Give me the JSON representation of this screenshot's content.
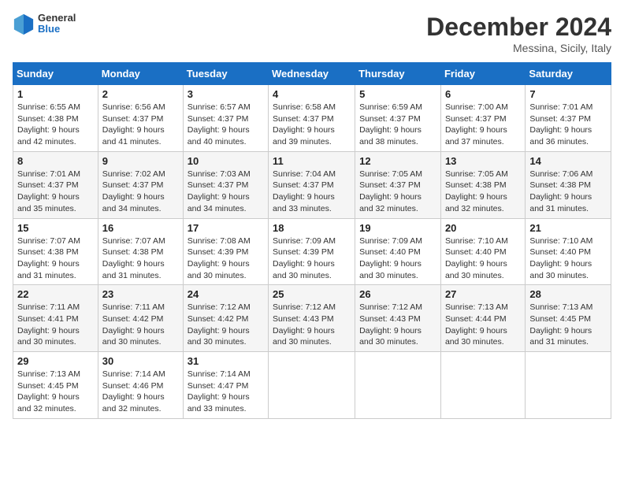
{
  "header": {
    "logo_general": "General",
    "logo_blue": "Blue",
    "title": "December 2024",
    "location": "Messina, Sicily, Italy"
  },
  "weekdays": [
    "Sunday",
    "Monday",
    "Tuesday",
    "Wednesday",
    "Thursday",
    "Friday",
    "Saturday"
  ],
  "weeks": [
    [
      {
        "day": "1",
        "sunrise": "6:55 AM",
        "sunset": "4:38 PM",
        "daylight": "9 hours and 42 minutes."
      },
      {
        "day": "2",
        "sunrise": "6:56 AM",
        "sunset": "4:37 PM",
        "daylight": "9 hours and 41 minutes."
      },
      {
        "day": "3",
        "sunrise": "6:57 AM",
        "sunset": "4:37 PM",
        "daylight": "9 hours and 40 minutes."
      },
      {
        "day": "4",
        "sunrise": "6:58 AM",
        "sunset": "4:37 PM",
        "daylight": "9 hours and 39 minutes."
      },
      {
        "day": "5",
        "sunrise": "6:59 AM",
        "sunset": "4:37 PM",
        "daylight": "9 hours and 38 minutes."
      },
      {
        "day": "6",
        "sunrise": "7:00 AM",
        "sunset": "4:37 PM",
        "daylight": "9 hours and 37 minutes."
      },
      {
        "day": "7",
        "sunrise": "7:01 AM",
        "sunset": "4:37 PM",
        "daylight": "9 hours and 36 minutes."
      }
    ],
    [
      {
        "day": "8",
        "sunrise": "7:01 AM",
        "sunset": "4:37 PM",
        "daylight": "9 hours and 35 minutes."
      },
      {
        "day": "9",
        "sunrise": "7:02 AM",
        "sunset": "4:37 PM",
        "daylight": "9 hours and 34 minutes."
      },
      {
        "day": "10",
        "sunrise": "7:03 AM",
        "sunset": "4:37 PM",
        "daylight": "9 hours and 34 minutes."
      },
      {
        "day": "11",
        "sunrise": "7:04 AM",
        "sunset": "4:37 PM",
        "daylight": "9 hours and 33 minutes."
      },
      {
        "day": "12",
        "sunrise": "7:05 AM",
        "sunset": "4:37 PM",
        "daylight": "9 hours and 32 minutes."
      },
      {
        "day": "13",
        "sunrise": "7:05 AM",
        "sunset": "4:38 PM",
        "daylight": "9 hours and 32 minutes."
      },
      {
        "day": "14",
        "sunrise": "7:06 AM",
        "sunset": "4:38 PM",
        "daylight": "9 hours and 31 minutes."
      }
    ],
    [
      {
        "day": "15",
        "sunrise": "7:07 AM",
        "sunset": "4:38 PM",
        "daylight": "9 hours and 31 minutes."
      },
      {
        "day": "16",
        "sunrise": "7:07 AM",
        "sunset": "4:38 PM",
        "daylight": "9 hours and 31 minutes."
      },
      {
        "day": "17",
        "sunrise": "7:08 AM",
        "sunset": "4:39 PM",
        "daylight": "9 hours and 30 minutes."
      },
      {
        "day": "18",
        "sunrise": "7:09 AM",
        "sunset": "4:39 PM",
        "daylight": "9 hours and 30 minutes."
      },
      {
        "day": "19",
        "sunrise": "7:09 AM",
        "sunset": "4:40 PM",
        "daylight": "9 hours and 30 minutes."
      },
      {
        "day": "20",
        "sunrise": "7:10 AM",
        "sunset": "4:40 PM",
        "daylight": "9 hours and 30 minutes."
      },
      {
        "day": "21",
        "sunrise": "7:10 AM",
        "sunset": "4:40 PM",
        "daylight": "9 hours and 30 minutes."
      }
    ],
    [
      {
        "day": "22",
        "sunrise": "7:11 AM",
        "sunset": "4:41 PM",
        "daylight": "9 hours and 30 minutes."
      },
      {
        "day": "23",
        "sunrise": "7:11 AM",
        "sunset": "4:42 PM",
        "daylight": "9 hours and 30 minutes."
      },
      {
        "day": "24",
        "sunrise": "7:12 AM",
        "sunset": "4:42 PM",
        "daylight": "9 hours and 30 minutes."
      },
      {
        "day": "25",
        "sunrise": "7:12 AM",
        "sunset": "4:43 PM",
        "daylight": "9 hours and 30 minutes."
      },
      {
        "day": "26",
        "sunrise": "7:12 AM",
        "sunset": "4:43 PM",
        "daylight": "9 hours and 30 minutes."
      },
      {
        "day": "27",
        "sunrise": "7:13 AM",
        "sunset": "4:44 PM",
        "daylight": "9 hours and 30 minutes."
      },
      {
        "day": "28",
        "sunrise": "7:13 AM",
        "sunset": "4:45 PM",
        "daylight": "9 hours and 31 minutes."
      }
    ],
    [
      {
        "day": "29",
        "sunrise": "7:13 AM",
        "sunset": "4:45 PM",
        "daylight": "9 hours and 32 minutes."
      },
      {
        "day": "30",
        "sunrise": "7:14 AM",
        "sunset": "4:46 PM",
        "daylight": "9 hours and 32 minutes."
      },
      {
        "day": "31",
        "sunrise": "7:14 AM",
        "sunset": "4:47 PM",
        "daylight": "9 hours and 33 minutes."
      },
      null,
      null,
      null,
      null
    ]
  ]
}
